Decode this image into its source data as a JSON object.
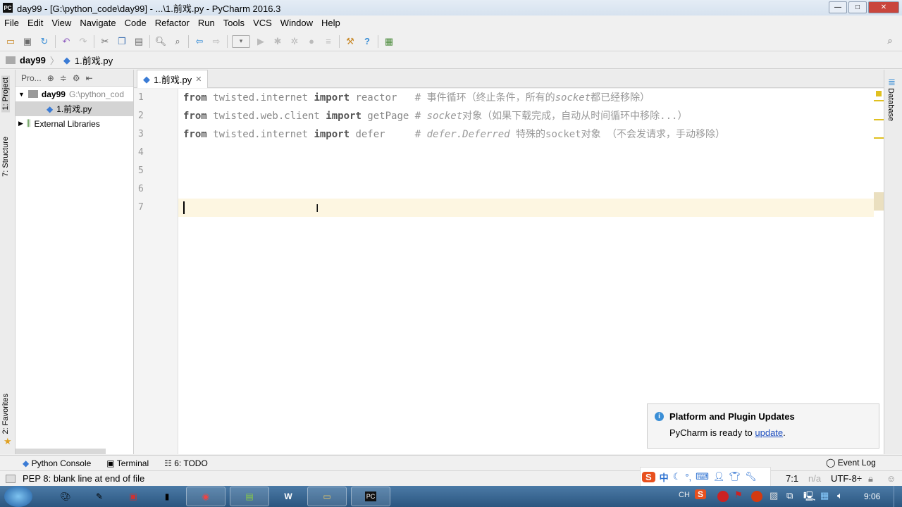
{
  "window": {
    "title": "day99 - [G:\\python_code\\day99] - ...\\1.前戏.py - PyCharm 2016.3",
    "app_icon": "PC"
  },
  "menu": [
    "File",
    "Edit",
    "View",
    "Navigate",
    "Code",
    "Refactor",
    "Run",
    "Tools",
    "VCS",
    "Window",
    "Help"
  ],
  "toolbar": {
    "icons": [
      "open-icon",
      "save-icon",
      "sync-icon",
      "undo-icon",
      "redo-icon",
      "cut-icon",
      "copy-icon",
      "paste-icon",
      "find-icon",
      "replace-icon",
      "back-icon",
      "forward-icon",
      "run-config-dropdown",
      "run-icon",
      "debug-icon",
      "coverage-icon",
      "profile-icon",
      "concurrency-icon",
      "settings-icon",
      "help-icon",
      "sdk-icon"
    ],
    "search_icon": "search-icon"
  },
  "breadcrumb": [
    "day99",
    "1.前戏.py"
  ],
  "left_tabs": [
    "1: Project",
    "7: Structure",
    "2: Favorites"
  ],
  "right_tabs": [
    "Database"
  ],
  "project": {
    "header": "Pro...",
    "tree": [
      {
        "label": "day99",
        "path": "G:\\python_cod"
      },
      {
        "label": "1.前戏.py"
      },
      {
        "label": "External Libraries"
      }
    ]
  },
  "editor": {
    "tab": "1.前戏.py",
    "lines": [
      {
        "n": "1",
        "kw1": "from",
        "mod": " twisted.internet ",
        "kw2": "import",
        "name": " reactor   ",
        "comment": "# 事件循环（终止条件，所有的",
        "ci": "socket",
        "comment2": "都已经移除）"
      },
      {
        "n": "2",
        "kw1": "from",
        "mod": " twisted.web.client ",
        "kw2": "import",
        "name": " getPage ",
        "comment": "# ",
        "ci": "socket",
        "comment2": "对象（如果下载完成，自动从时间循环中移除...）"
      },
      {
        "n": "3",
        "kw1": "from",
        "mod": " twisted.internet ",
        "kw2": "import",
        "name": " defer     ",
        "comment": "# ",
        "ci": "defer.Deferred",
        "comment2": " 特殊的socket对象 （不会发请求，手动移除）"
      },
      {
        "n": "4"
      },
      {
        "n": "5"
      },
      {
        "n": "6"
      },
      {
        "n": "7"
      }
    ]
  },
  "notification": {
    "title": "Platform and Plugin Updates",
    "body": "PyCharm is ready to ",
    "link": "update",
    "end": "."
  },
  "bottom_tabs": [
    "Python Console",
    "Terminal",
    "6: TODO"
  ],
  "event_log": "Event Log",
  "status": {
    "message": "PEP 8: blank line at end of file",
    "position": "7:1",
    "na": "n/a",
    "encoding": "UTF-8÷"
  },
  "taskbar": {
    "lang": "CH",
    "clock": "9:06",
    "ime": "中"
  }
}
